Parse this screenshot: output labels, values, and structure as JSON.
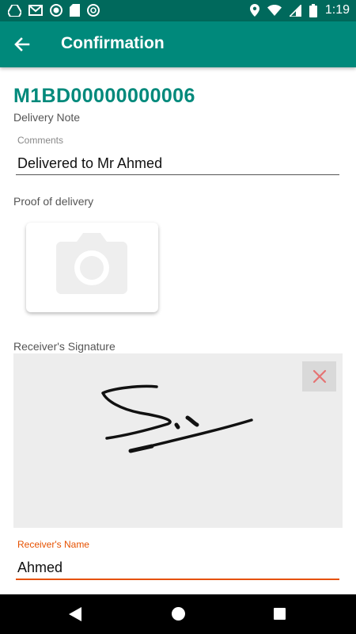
{
  "status_bar": {
    "time": "1:19",
    "left_icons": [
      "drive-icon",
      "gmail-icon",
      "record-icon",
      "sd-card-icon",
      "chrome-icon"
    ],
    "right_icons": [
      "location-icon",
      "wifi-icon",
      "signal-icon",
      "battery-icon"
    ]
  },
  "app_bar": {
    "title": "Confirmation",
    "color": "#00897b"
  },
  "order": {
    "id": "M1BD00000000006",
    "subtitle": "Delivery Note"
  },
  "comments": {
    "label": "Comments",
    "value": "Delivered to Mr Ahmed"
  },
  "proof": {
    "label": "Proof of delivery",
    "icon": "camera-icon"
  },
  "signature": {
    "label": "Receiver's Signature",
    "clear_icon": "close-icon"
  },
  "receiver": {
    "label": "Receiver's Name",
    "value": "Ahmed",
    "accent": "#e65100"
  },
  "nav_bar": {
    "icons": [
      "back-triangle-icon",
      "home-circle-icon",
      "recents-square-icon"
    ]
  }
}
